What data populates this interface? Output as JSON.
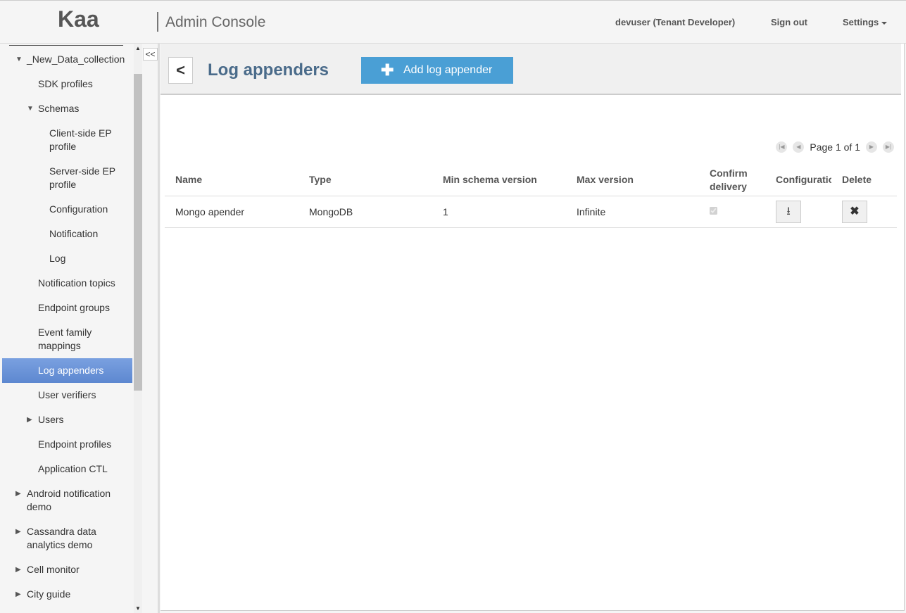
{
  "header": {
    "logo": "Kaa",
    "app_title": "Admin Console",
    "user": "devuser (Tenant Developer)",
    "sign_out": "Sign out",
    "settings": "Settings"
  },
  "sidebar": {
    "collapse_label": "<<",
    "items": [
      {
        "label": "_New_Data_collection",
        "level": 0,
        "arrow": "expanded"
      },
      {
        "label": "SDK profiles",
        "level": 1,
        "arrow": "none"
      },
      {
        "label": "Schemas",
        "level": 1,
        "arrow": "expanded"
      },
      {
        "label": "Client-side EP profile",
        "level": 2,
        "arrow": "none"
      },
      {
        "label": "Server-side EP profile",
        "level": 2,
        "arrow": "none"
      },
      {
        "label": "Configuration",
        "level": 2,
        "arrow": "none"
      },
      {
        "label": "Notification",
        "level": 2,
        "arrow": "none"
      },
      {
        "label": "Log",
        "level": 2,
        "arrow": "none"
      },
      {
        "label": "Notification topics",
        "level": 1,
        "arrow": "none"
      },
      {
        "label": "Endpoint groups",
        "level": 1,
        "arrow": "none"
      },
      {
        "label": "Event family mappings",
        "level": 1,
        "arrow": "none"
      },
      {
        "label": "Log appenders",
        "level": 1,
        "arrow": "none",
        "active": true
      },
      {
        "label": "User verifiers",
        "level": 1,
        "arrow": "none"
      },
      {
        "label": "Users",
        "level": 1,
        "arrow": "collapsed"
      },
      {
        "label": "Endpoint profiles",
        "level": 1,
        "arrow": "none"
      },
      {
        "label": "Application CTL",
        "level": 1,
        "arrow": "none"
      },
      {
        "label": "Android notification demo",
        "level": 0,
        "arrow": "collapsed"
      },
      {
        "label": "Cassandra data analytics demo",
        "level": 0,
        "arrow": "collapsed"
      },
      {
        "label": "Cell monitor",
        "level": 0,
        "arrow": "collapsed"
      },
      {
        "label": "City guide",
        "level": 0,
        "arrow": "collapsed"
      }
    ]
  },
  "main": {
    "back_label": "<",
    "title": "Log appenders",
    "add_button": "Add log appender",
    "pager": "Page 1 of 1",
    "columns": [
      "Name",
      "Type",
      "Min schema version",
      "Max version",
      "Confirm delivery",
      "Configuratio",
      "Delete"
    ],
    "rows": [
      {
        "name": "Mongo apender",
        "type": "MongoDB",
        "min": "1",
        "max": "Infinite",
        "confirm": true
      }
    ]
  },
  "colors": {
    "accent": "#4a9fd5",
    "active": "#6a93d8",
    "title": "#4a6b8a"
  }
}
